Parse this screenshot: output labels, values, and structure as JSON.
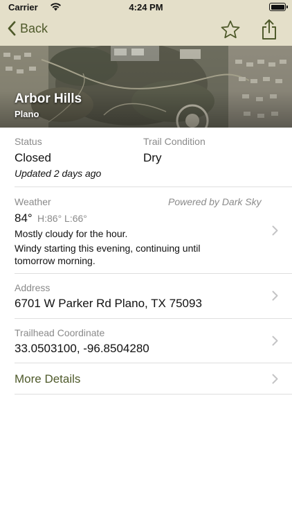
{
  "status_bar": {
    "carrier": "Carrier",
    "time": "4:24 PM"
  },
  "nav": {
    "back_label": "Back"
  },
  "header": {
    "title": "Arbor Hills",
    "subtitle": "Plano"
  },
  "status": {
    "label": "Status",
    "value": "Closed",
    "updated": "Updated 2 days ago"
  },
  "trail_condition": {
    "label": "Trail Condition",
    "value": "Dry"
  },
  "weather": {
    "label": "Weather",
    "powered_by": "Powered by Dark Sky",
    "temperature": "84°",
    "high_low": "H:86° L:66°",
    "summary_hour": "Mostly cloudy for the hour.",
    "summary_line1": "Windy starting this evening, continuing until",
    "summary_line2": "tomorrow morning."
  },
  "address": {
    "label": "Address",
    "value": "6701 W Parker Rd Plano, TX 75093"
  },
  "coordinate": {
    "label": "Trailhead Coordinate",
    "value": "33.0503100, -96.8504280"
  },
  "more_details": {
    "label": "More Details"
  },
  "colors": {
    "accent": "#4f5a2b",
    "bar_bg": "#e4dfc9"
  }
}
